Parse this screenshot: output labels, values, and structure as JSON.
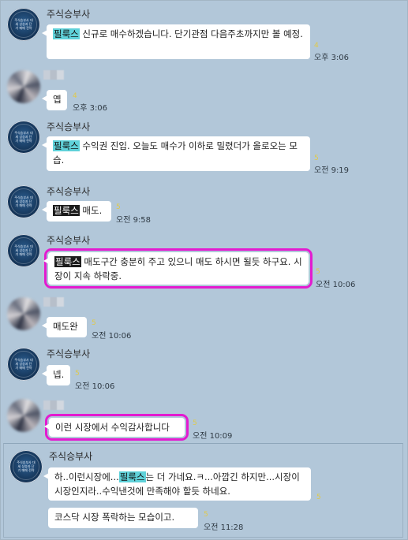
{
  "sender_name": "주식승부사",
  "avatar_logo_text": "주식승부사 대세 상승과 단기 매매 전략",
  "messages": [
    {
      "pre": "",
      "tag": "필룩스",
      "post": " 신규로 매수하겠습니다. 단기관점 다음주초까지만 볼 예정.",
      "count": "4",
      "time": "오후 3:06"
    },
    {
      "text": "옙",
      "count": "4",
      "time": "오후 3:06"
    },
    {
      "pre": "",
      "tag": "필룩스",
      "post": " 수익권 진입. 오늘도 매수가 이하로 밀렸더가 올로오는 모습.",
      "count": "5",
      "time": "오전 9:19"
    },
    {
      "pre": "",
      "tag": "필룩스",
      "post": " 매도.",
      "count": "5",
      "time": "오전 9:58"
    },
    {
      "pre": "",
      "tag": "필룩스",
      "post": " 매도구간 충분히 주고 있으니 매도 하시면 될듯 하구요. 시장이 지속 하락중.",
      "count": "5",
      "time": "오전 10:06"
    },
    {
      "text": "매도완",
      "count": "5",
      "time": "오전 10:06"
    },
    {
      "text": "넵.",
      "count": "5",
      "time": "오전 10:06"
    },
    {
      "text": "이런 시장에서 수익감사합니다",
      "count": "5",
      "time": "오전 10:09"
    },
    {
      "pre": "하..이런시장에...",
      "tag": "필룩스",
      "post": "는 더 가네요.ㅋ...아깝긴 하지만...시장이 시장인지라..수익낸것에 만족해야 할듯 하네요.",
      "count": "5",
      "time": ""
    },
    {
      "text": "코스닥 시장 폭락하는 모습이고.",
      "count": "5",
      "time": "오전 11:28"
    }
  ]
}
